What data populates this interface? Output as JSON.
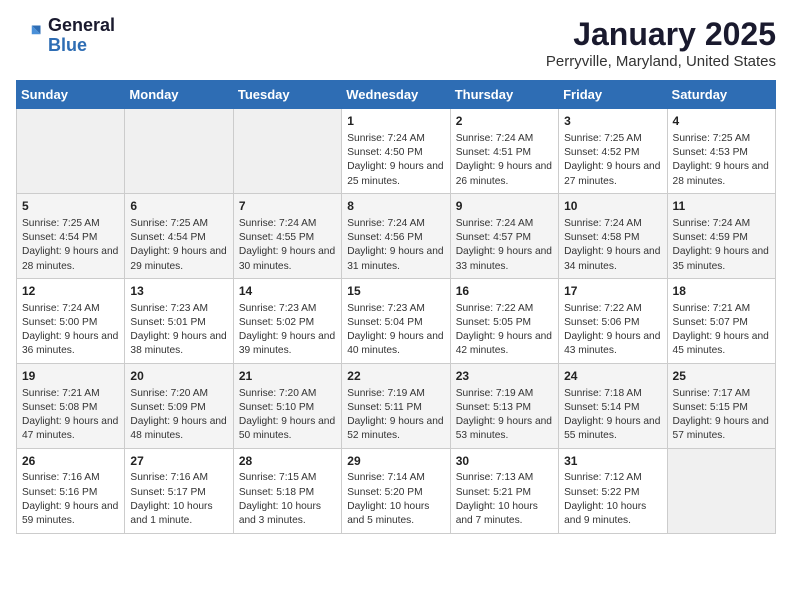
{
  "header": {
    "logo_line1": "General",
    "logo_line2": "Blue",
    "title": "January 2025",
    "subtitle": "Perryville, Maryland, United States"
  },
  "days_of_week": [
    "Sunday",
    "Monday",
    "Tuesday",
    "Wednesday",
    "Thursday",
    "Friday",
    "Saturday"
  ],
  "weeks": [
    [
      {
        "num": "",
        "info": ""
      },
      {
        "num": "",
        "info": ""
      },
      {
        "num": "",
        "info": ""
      },
      {
        "num": "1",
        "info": "Sunrise: 7:24 AM\nSunset: 4:50 PM\nDaylight: 9 hours and 25 minutes."
      },
      {
        "num": "2",
        "info": "Sunrise: 7:24 AM\nSunset: 4:51 PM\nDaylight: 9 hours and 26 minutes."
      },
      {
        "num": "3",
        "info": "Sunrise: 7:25 AM\nSunset: 4:52 PM\nDaylight: 9 hours and 27 minutes."
      },
      {
        "num": "4",
        "info": "Sunrise: 7:25 AM\nSunset: 4:53 PM\nDaylight: 9 hours and 28 minutes."
      }
    ],
    [
      {
        "num": "5",
        "info": "Sunrise: 7:25 AM\nSunset: 4:54 PM\nDaylight: 9 hours and 28 minutes."
      },
      {
        "num": "6",
        "info": "Sunrise: 7:25 AM\nSunset: 4:54 PM\nDaylight: 9 hours and 29 minutes."
      },
      {
        "num": "7",
        "info": "Sunrise: 7:24 AM\nSunset: 4:55 PM\nDaylight: 9 hours and 30 minutes."
      },
      {
        "num": "8",
        "info": "Sunrise: 7:24 AM\nSunset: 4:56 PM\nDaylight: 9 hours and 31 minutes."
      },
      {
        "num": "9",
        "info": "Sunrise: 7:24 AM\nSunset: 4:57 PM\nDaylight: 9 hours and 33 minutes."
      },
      {
        "num": "10",
        "info": "Sunrise: 7:24 AM\nSunset: 4:58 PM\nDaylight: 9 hours and 34 minutes."
      },
      {
        "num": "11",
        "info": "Sunrise: 7:24 AM\nSunset: 4:59 PM\nDaylight: 9 hours and 35 minutes."
      }
    ],
    [
      {
        "num": "12",
        "info": "Sunrise: 7:24 AM\nSunset: 5:00 PM\nDaylight: 9 hours and 36 minutes."
      },
      {
        "num": "13",
        "info": "Sunrise: 7:23 AM\nSunset: 5:01 PM\nDaylight: 9 hours and 38 minutes."
      },
      {
        "num": "14",
        "info": "Sunrise: 7:23 AM\nSunset: 5:02 PM\nDaylight: 9 hours and 39 minutes."
      },
      {
        "num": "15",
        "info": "Sunrise: 7:23 AM\nSunset: 5:04 PM\nDaylight: 9 hours and 40 minutes."
      },
      {
        "num": "16",
        "info": "Sunrise: 7:22 AM\nSunset: 5:05 PM\nDaylight: 9 hours and 42 minutes."
      },
      {
        "num": "17",
        "info": "Sunrise: 7:22 AM\nSunset: 5:06 PM\nDaylight: 9 hours and 43 minutes."
      },
      {
        "num": "18",
        "info": "Sunrise: 7:21 AM\nSunset: 5:07 PM\nDaylight: 9 hours and 45 minutes."
      }
    ],
    [
      {
        "num": "19",
        "info": "Sunrise: 7:21 AM\nSunset: 5:08 PM\nDaylight: 9 hours and 47 minutes."
      },
      {
        "num": "20",
        "info": "Sunrise: 7:20 AM\nSunset: 5:09 PM\nDaylight: 9 hours and 48 minutes."
      },
      {
        "num": "21",
        "info": "Sunrise: 7:20 AM\nSunset: 5:10 PM\nDaylight: 9 hours and 50 minutes."
      },
      {
        "num": "22",
        "info": "Sunrise: 7:19 AM\nSunset: 5:11 PM\nDaylight: 9 hours and 52 minutes."
      },
      {
        "num": "23",
        "info": "Sunrise: 7:19 AM\nSunset: 5:13 PM\nDaylight: 9 hours and 53 minutes."
      },
      {
        "num": "24",
        "info": "Sunrise: 7:18 AM\nSunset: 5:14 PM\nDaylight: 9 hours and 55 minutes."
      },
      {
        "num": "25",
        "info": "Sunrise: 7:17 AM\nSunset: 5:15 PM\nDaylight: 9 hours and 57 minutes."
      }
    ],
    [
      {
        "num": "26",
        "info": "Sunrise: 7:16 AM\nSunset: 5:16 PM\nDaylight: 9 hours and 59 minutes."
      },
      {
        "num": "27",
        "info": "Sunrise: 7:16 AM\nSunset: 5:17 PM\nDaylight: 10 hours and 1 minute."
      },
      {
        "num": "28",
        "info": "Sunrise: 7:15 AM\nSunset: 5:18 PM\nDaylight: 10 hours and 3 minutes."
      },
      {
        "num": "29",
        "info": "Sunrise: 7:14 AM\nSunset: 5:20 PM\nDaylight: 10 hours and 5 minutes."
      },
      {
        "num": "30",
        "info": "Sunrise: 7:13 AM\nSunset: 5:21 PM\nDaylight: 10 hours and 7 minutes."
      },
      {
        "num": "31",
        "info": "Sunrise: 7:12 AM\nSunset: 5:22 PM\nDaylight: 10 hours and 9 minutes."
      },
      {
        "num": "",
        "info": ""
      }
    ]
  ]
}
